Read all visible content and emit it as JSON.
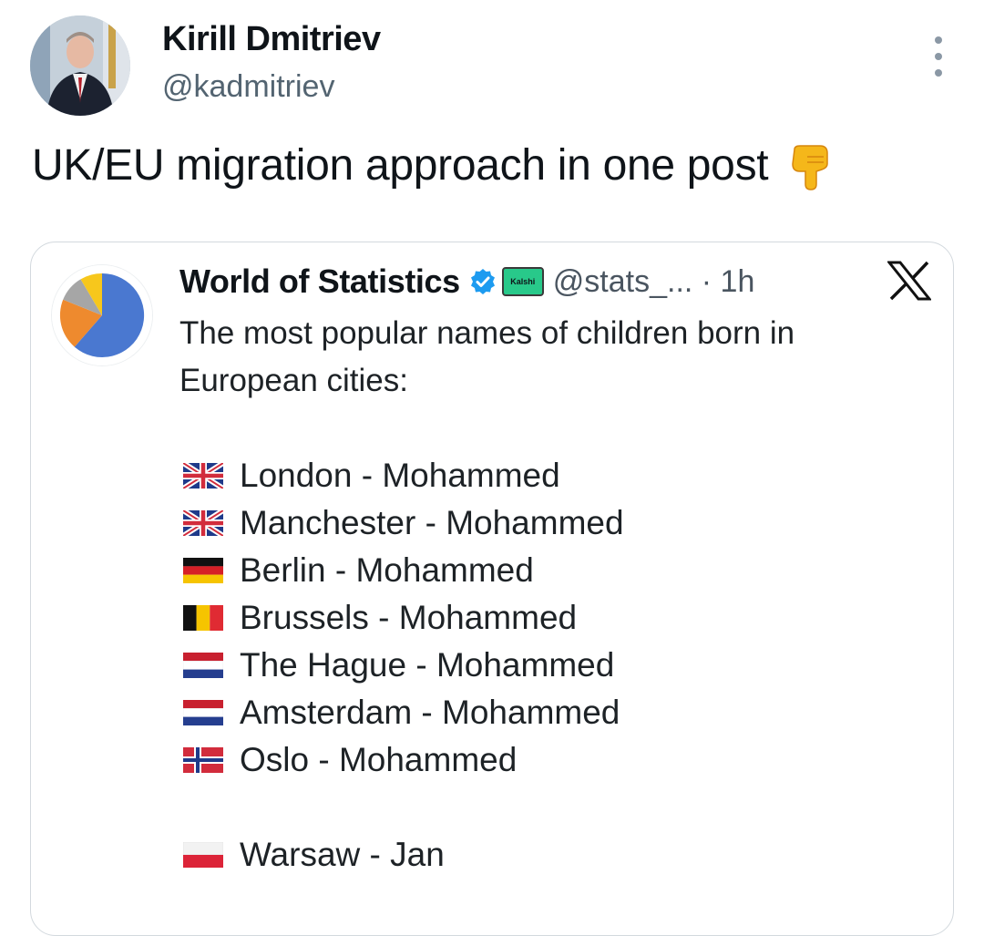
{
  "author": {
    "name": "Kirill Dmitriev",
    "handle": "@kadmitriev"
  },
  "tweet": {
    "text": "UK/EU migration approach in one post",
    "emoji_icon": "backhand-index-pointing-down-icon"
  },
  "quoted": {
    "name": "World of Statistics",
    "badge_text": "Kalshi",
    "handle_time": "@stats_... · 1h",
    "intro": "The most popular names of children born in European cities:",
    "entries": [
      {
        "text": "London - Mohammed",
        "flag": "uk-flag-icon"
      },
      {
        "text": "Manchester - Mohammed",
        "flag": "uk-flag-icon"
      },
      {
        "text": "Berlin - Mohammed",
        "flag": "germany-flag-icon"
      },
      {
        "text": "Brussels - Mohammed",
        "flag": "belgium-flag-icon"
      },
      {
        "text": "The Hague - Mohammed",
        "flag": "netherlands-flag-icon"
      },
      {
        "text": "Amsterdam - Mohammed",
        "flag": "netherlands-flag-icon"
      },
      {
        "text": "Oslo - Mohammed",
        "flag": "norway-flag-icon"
      },
      {
        "text": "Warsaw - Jan",
        "flag": "poland-flag-icon"
      }
    ]
  },
  "colors": {
    "verified": "#1d9bf0",
    "kalshi": "#28c98a",
    "pie_blue": "#4a78d0",
    "pie_orange": "#ee8a2e",
    "pie_gray": "#a6a6a6",
    "pie_yellow": "#f7c71c"
  }
}
